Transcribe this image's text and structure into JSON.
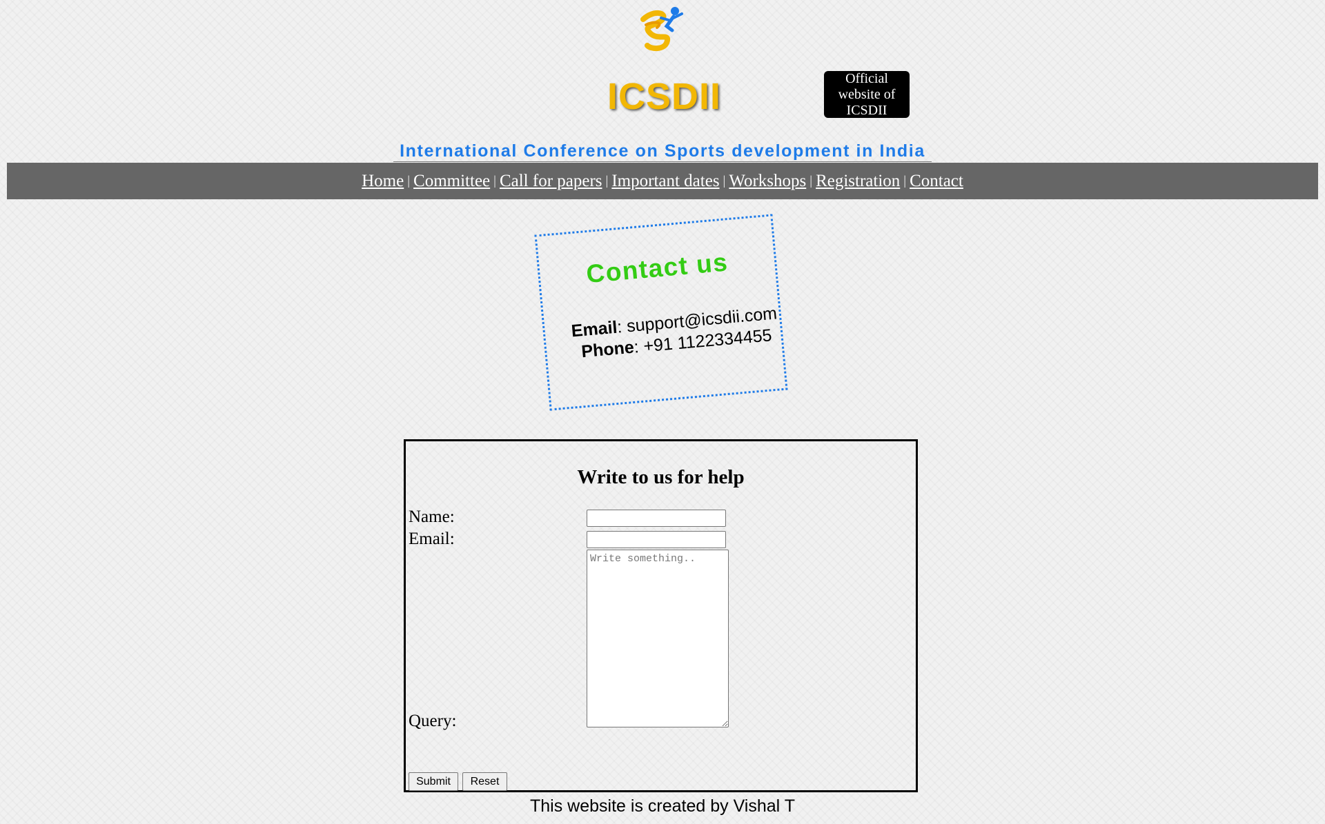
{
  "header": {
    "logo_icon": "sports-runner-logo-icon",
    "site_title": "ICSDII",
    "official_badge": "Official website of ICSDII",
    "subtitle": "International Conference on Sports development in India"
  },
  "nav": {
    "items": [
      {
        "label": "Home"
      },
      {
        "label": "Committee"
      },
      {
        "label": "Call for papers"
      },
      {
        "label": "Important dates"
      },
      {
        "label": "Workshops"
      },
      {
        "label": "Registration"
      },
      {
        "label": "Contact"
      }
    ],
    "separator": "|"
  },
  "contact": {
    "title": "Contact us",
    "email_label": "Email",
    "email_value": ": support@icsdii.com",
    "phone_label": "Phone",
    "phone_value": ": +91 1122334455"
  },
  "form": {
    "heading": "Write to us for help",
    "name_label": "Name:",
    "name_value": "",
    "email_label": "Email:",
    "email_value": "",
    "query_label": "Query:",
    "query_placeholder": "Write something..",
    "submit_label": "Submit",
    "reset_label": "Reset"
  },
  "footer": {
    "credit": "This website is created by Vishal T"
  },
  "colors": {
    "title_yellow": "#f2b705",
    "subtitle_blue": "#1e7be8",
    "nav_bg": "#666666",
    "contact_green": "#33cc14"
  }
}
